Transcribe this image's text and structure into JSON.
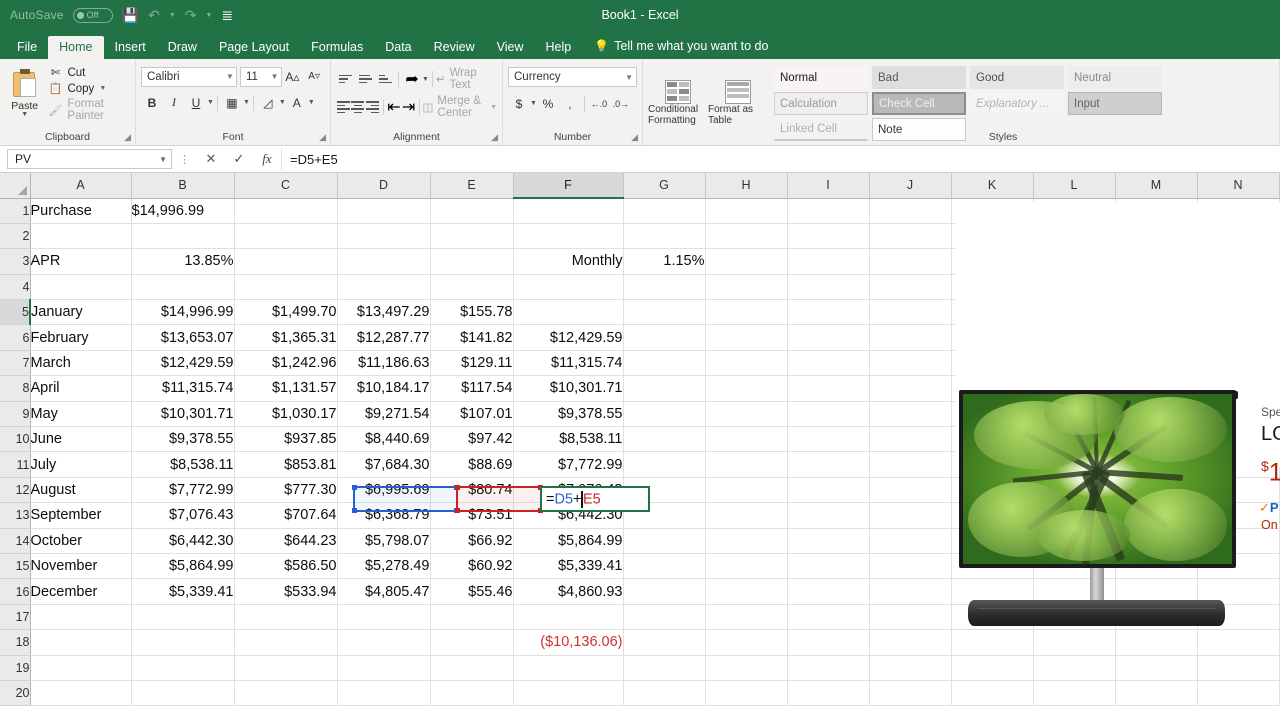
{
  "window": {
    "title": "Book1  -  Excel"
  },
  "quick_access": {
    "autosave_label": "AutoSave",
    "autosave_state": "Off",
    "save_icon": "save-icon",
    "undo_icon": "undo-icon",
    "redo_icon": "redo-icon",
    "customize_icon": "customize-quick-access-icon"
  },
  "ribbon": {
    "tabs": [
      {
        "label": "File",
        "active": false
      },
      {
        "label": "Home",
        "active": true
      },
      {
        "label": "Insert",
        "active": false
      },
      {
        "label": "Draw",
        "active": false
      },
      {
        "label": "Page Layout",
        "active": false
      },
      {
        "label": "Formulas",
        "active": false
      },
      {
        "label": "Data",
        "active": false
      },
      {
        "label": "Review",
        "active": false
      },
      {
        "label": "View",
        "active": false
      },
      {
        "label": "Help",
        "active": false
      }
    ],
    "tell_me": "Tell me what you want to do",
    "groups": {
      "clipboard": {
        "label": "Clipboard",
        "paste": "Paste",
        "cut": "Cut",
        "copy": "Copy",
        "format_painter": "Format Painter"
      },
      "font": {
        "label": "Font",
        "font_name": "Calibri",
        "font_size": "11",
        "bold": "B",
        "italic": "I",
        "underline": "U"
      },
      "alignment": {
        "label": "Alignment",
        "wrap_text": "Wrap Text",
        "merge_center": "Merge & Center"
      },
      "number": {
        "label": "Number",
        "format": "Currency",
        "accounting": "$",
        "percent": "%",
        "comma": ",",
        "increase_decimal": ".00",
        "decrease_decimal": ".00"
      },
      "styles": {
        "label": "Styles",
        "conditional_formatting": "Conditional Formatting",
        "format_as_table": "Format as Table",
        "gallery": [
          "Normal",
          "Bad",
          "Good",
          "Neutral",
          "Calculation",
          "Check Cell",
          "Explanatory ...",
          "Input",
          "Linked Cell",
          "Note"
        ]
      }
    }
  },
  "formula_bar": {
    "name_box": "PV",
    "cancel_icon": "cancel-icon",
    "enter_icon": "enter-icon",
    "function_icon": "insert-function-icon",
    "formula": "=D5+E5",
    "formula_parts": {
      "prefix": "=",
      "ref1": "D5",
      "op": "+",
      "ref2": "E5"
    }
  },
  "sheet": {
    "columns": [
      "A",
      "B",
      "C",
      "D",
      "E",
      "F",
      "G",
      "H",
      "I",
      "J",
      "K",
      "L",
      "M",
      "N"
    ],
    "selected_column": "F",
    "selected_row": "5",
    "rows": [
      {
        "n": "1",
        "A": "Purchase",
        "B": "$14,996.99",
        "C": "",
        "D": "",
        "E": "",
        "F": "",
        "G": ""
      },
      {
        "n": "2",
        "A": "",
        "B": "",
        "C": "",
        "D": "",
        "E": "",
        "F": "",
        "G": ""
      },
      {
        "n": "3",
        "A": "APR",
        "B": "13.85%",
        "C": "",
        "D": "",
        "E": "",
        "F": "Monthly",
        "G": "1.15%"
      },
      {
        "n": "4",
        "A": "",
        "B": "",
        "C": "",
        "D": "",
        "E": "",
        "F": "",
        "G": ""
      },
      {
        "n": "5",
        "A": "January",
        "B": "$14,996.99",
        "C": "$1,499.70",
        "D": "$13,497.29",
        "E": "$155.78",
        "F": "",
        "G": ""
      },
      {
        "n": "6",
        "A": "February",
        "B": "$13,653.07",
        "C": "$1,365.31",
        "D": "$12,287.77",
        "E": "$141.82",
        "F": "$12,429.59",
        "G": ""
      },
      {
        "n": "7",
        "A": "March",
        "B": "$12,429.59",
        "C": "$1,242.96",
        "D": "$11,186.63",
        "E": "$129.11",
        "F": "$11,315.74",
        "G": ""
      },
      {
        "n": "8",
        "A": "April",
        "B": "$11,315.74",
        "C": "$1,131.57",
        "D": "$10,184.17",
        "E": "$117.54",
        "F": "$10,301.71",
        "G": ""
      },
      {
        "n": "9",
        "A": "May",
        "B": "$10,301.71",
        "C": "$1,030.17",
        "D": "$9,271.54",
        "E": "$107.01",
        "F": "$9,378.55",
        "G": ""
      },
      {
        "n": "10",
        "A": "June",
        "B": "$9,378.55",
        "C": "$937.85",
        "D": "$8,440.69",
        "E": "$97.42",
        "F": "$8,538.11",
        "G": ""
      },
      {
        "n": "11",
        "A": "July",
        "B": "$8,538.11",
        "C": "$853.81",
        "D": "$7,684.30",
        "E": "$88.69",
        "F": "$7,772.99",
        "G": ""
      },
      {
        "n": "12",
        "A": "August",
        "B": "$7,772.99",
        "C": "$777.30",
        "D": "$6,995.69",
        "E": "$80.74",
        "F": "$7,076.43",
        "G": ""
      },
      {
        "n": "13",
        "A": "September",
        "B": "$7,076.43",
        "C": "$707.64",
        "D": "$6,368.79",
        "E": "$73.51",
        "F": "$6,442.30",
        "G": ""
      },
      {
        "n": "14",
        "A": "October",
        "B": "$6,442.30",
        "C": "$644.23",
        "D": "$5,798.07",
        "E": "$66.92",
        "F": "$5,864.99",
        "G": ""
      },
      {
        "n": "15",
        "A": "November",
        "B": "$5,864.99",
        "C": "$586.50",
        "D": "$5,278.49",
        "E": "$60.92",
        "F": "$5,339.41",
        "G": ""
      },
      {
        "n": "16",
        "A": "December",
        "B": "$5,339.41",
        "C": "$533.94",
        "D": "$4,805.47",
        "E": "$55.46",
        "F": "$4,860.93",
        "G": ""
      },
      {
        "n": "17",
        "A": "",
        "B": "",
        "C": "",
        "D": "",
        "E": "",
        "F": "",
        "G": ""
      },
      {
        "n": "18",
        "A": "",
        "B": "",
        "C": "",
        "D": "",
        "E": "",
        "F": "($10,136.06)",
        "G": ""
      },
      {
        "n": "19",
        "A": "",
        "B": "",
        "C": "",
        "D": "",
        "E": "",
        "F": "",
        "G": ""
      },
      {
        "n": "20",
        "A": "",
        "B": "",
        "C": "",
        "D": "",
        "E": "",
        "F": "",
        "G": ""
      }
    ],
    "editing_cell": {
      "ref": "F5",
      "text": "=D5+E5"
    },
    "references": [
      {
        "ref": "D5",
        "color": "#2a5fd0"
      },
      {
        "ref": "E5",
        "color": "#cc2222"
      }
    ]
  },
  "product_overlay": {
    "image_alt": "lg-oled-tv-forest-canopy-image",
    "spec_line": "Spe",
    "title": "LG",
    "price_currency": "$",
    "price": "1",
    "prime": "P",
    "stock": "On"
  },
  "colors": {
    "excel_green": "#217346",
    "ribbon_bg": "#f3f2f1",
    "ref_blue": "#2a5fd0",
    "ref_red": "#cc2222",
    "negative_red": "#d03030"
  }
}
